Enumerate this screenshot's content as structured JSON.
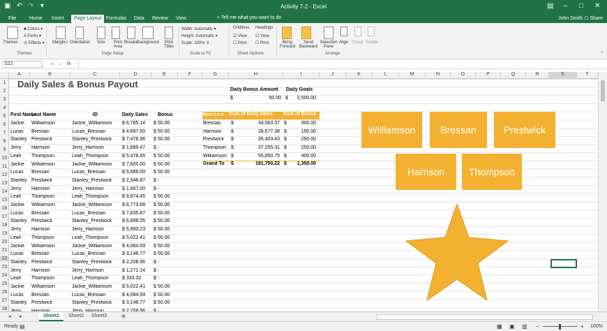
{
  "window": {
    "title": "Activity 7-2 - Excel"
  },
  "tabs": [
    {
      "label": "File"
    },
    {
      "label": "Home"
    },
    {
      "label": "Insert"
    },
    {
      "label": "Page Layout"
    },
    {
      "label": "Formulas"
    },
    {
      "label": "Data"
    },
    {
      "label": "Review"
    },
    {
      "label": "View"
    }
  ],
  "tell_me": "Tell me what you want to do",
  "user": {
    "name": "John Smith",
    "share": "Share"
  },
  "ribbon": {
    "themes": {
      "themes": "Themes",
      "colors": "Colors",
      "fonts": "Fonts",
      "effects": "Effects",
      "group": "Themes"
    },
    "page_setup": {
      "margins": "Margins",
      "orientation": "Orientation",
      "size": "Size",
      "print_area": "Print Area",
      "breaks": "Breaks",
      "background": "Background",
      "print_titles": "Print Titles",
      "group": "Page Setup"
    },
    "scale": {
      "width": "Width:",
      "width_val": "Automatic",
      "height": "Height:",
      "height_val": "Automatic",
      "scale": "Scale:",
      "scale_val": "100%",
      "group": "Scale to Fit"
    },
    "sheet_options": {
      "gridlines": "Gridlines",
      "headings": "Headings",
      "view": "View",
      "print": "Print",
      "group": "Sheet Options"
    },
    "arrange": {
      "bring_forward": "Bring Forward",
      "send_backward": "Send Backward",
      "selection_pane": "Selection Pane",
      "align": "Align",
      "group_btn": "Group",
      "rotate": "Rotate",
      "group": "Arrange"
    }
  },
  "formula_bar": {
    "name_box": "S22",
    "fx": "fx"
  },
  "columns": [
    "A",
    "B",
    "C",
    "D",
    "E",
    "F",
    "G",
    "H",
    "I",
    "J",
    "K",
    "L",
    "M",
    "N",
    "O",
    "P",
    "Q",
    "R",
    "S",
    "T"
  ],
  "rows": [
    "1",
    "2",
    "3",
    "4",
    "5",
    "6",
    "7",
    "8",
    "9",
    "10",
    "11",
    "12",
    "13",
    "14",
    "15",
    "16",
    "17",
    "18",
    "19",
    "20",
    "21",
    "22",
    "23",
    "24",
    "25",
    "26",
    "27",
    "28"
  ],
  "sheet": {
    "title": "Daily Sales & Bonus Payout",
    "headers": {
      "first": "First Name",
      "last": "Last Name",
      "id": "ID",
      "sales": "Daily Sales",
      "bonus": "Bonus"
    },
    "rows": [
      [
        "Jackie",
        "Williamson",
        "Jackie_Williamson",
        "$ 6,785.14",
        "$ 50.00"
      ],
      [
        "Lucas",
        "Bressan",
        "Lucas_Bressan",
        "$ 4,687.50",
        "$ 50.00"
      ],
      [
        "Stanley",
        "Prestwick",
        "Stanley_Prestwick",
        "$ 7,478.96",
        "$ 50.00"
      ],
      [
        "Jerry",
        "Harrison",
        "Jerry_Harrison",
        "$ 1,689.47",
        "$ -"
      ],
      [
        "Leah",
        "Thompson",
        "Leah_Thompson",
        "$ 5,478.45",
        "$ 50.00"
      ],
      [
        "Jackie",
        "Williamson",
        "Jackie_Williamson",
        "$ 7,600.00",
        "$ 50.00"
      ],
      [
        "Lucas",
        "Bressan",
        "Lucas_Bressan",
        "$ 5,689.00",
        "$ 50.00"
      ],
      [
        "Stanley",
        "Prestwick",
        "Stanley_Prestwick",
        "$ 2,346.87",
        "$ -"
      ],
      [
        "Jerry",
        "Harrison",
        "Jerry_Harrison",
        "$ 1,687.00",
        "$ -"
      ],
      [
        "Leah",
        "Thompson",
        "Leah_Thompson",
        "$ 9,874.45",
        "$ 50.00"
      ],
      [
        "Jackie",
        "Williamson",
        "Jackie_Williamson",
        "$ 8,773.68",
        "$ 50.00"
      ],
      [
        "Lucas",
        "Bressan",
        "Lucas_Bressan",
        "$ 7,835.87",
        "$ 50.00"
      ],
      [
        "Stanley",
        "Prestwick",
        "Stanley_Prestwick",
        "$ 6,898.05",
        "$ 50.00"
      ],
      [
        "Jerry",
        "Harrison",
        "Jerry_Harrison",
        "$ 5,960.23",
        "$ 50.00"
      ],
      [
        "Leah",
        "Thompson",
        "Leah_Thompson",
        "$ 5,022.41",
        "$ 50.00"
      ],
      [
        "Jackie",
        "Williamson",
        "Jackie_Williamson",
        "$ 4,084.59",
        "$ 50.00"
      ],
      [
        "Lucas",
        "Bressan",
        "Lucas_Bressan",
        "$ 3,146.77",
        "$ 50.00"
      ],
      [
        "Stanley",
        "Prestwick",
        "Stanley_Prestwick",
        "$ 2,208.96",
        "$ -"
      ],
      [
        "Jerry",
        "Harrison",
        "Jerry_Harrison",
        "$ 1,271.14",
        "$ -"
      ],
      [
        "Leah",
        "Thompson",
        "Leah_Thompson",
        "$ 333.32",
        "$ -"
      ],
      [
        "Jackie",
        "Williamson",
        "Jackie_Williamson",
        "$ 5,022.41",
        "$ 50.00"
      ],
      [
        "Lucas",
        "Bressan",
        "Lucas_Bressan",
        "$ 4,084.59",
        "$ 50.00"
      ],
      [
        "Stanley",
        "Prestwick",
        "Stanley_Prestwick",
        "$ 3,146.77",
        "$ 50.00"
      ],
      [
        "Jerry",
        "Harrison",
        "Jerry_Harrison",
        "$ 2,208.96",
        "$ -"
      ]
    ],
    "bonus_header": {
      "amount": "Daily Bonus Amount",
      "goals": "Daily Goals"
    },
    "bonus_values": {
      "amount": "50.00",
      "goals": "2,500.00",
      "currency": "$"
    },
    "pivot": {
      "headers": [
        "Row La",
        "Sum of Daily Sales",
        "Sum of Bonus"
      ],
      "rows": [
        [
          "Bressan",
          "34,563.37",
          "300.00"
        ],
        [
          "Harrison",
          "28,677.38",
          "150.00"
        ],
        [
          "Prestwick",
          "35,403.43",
          "250.00"
        ],
        [
          "Thompson",
          "37,255.31",
          "250.00"
        ],
        [
          "Williamson",
          "55,850.75",
          "400.00"
        ]
      ],
      "total": [
        "Grand To",
        "191,750.22",
        "1,350.00"
      ]
    }
  },
  "shapes": [
    "Williamson",
    "Bressan",
    "Prestwick",
    "Harrison",
    "Thompson"
  ],
  "sheet_tabs": [
    "Sheet1",
    "Sheet2",
    "Sheet3"
  ],
  "status": {
    "ready": "Ready",
    "zoom": "100%"
  },
  "colors": {
    "excel_green": "#217346",
    "accent_orange": "#f4b131"
  }
}
